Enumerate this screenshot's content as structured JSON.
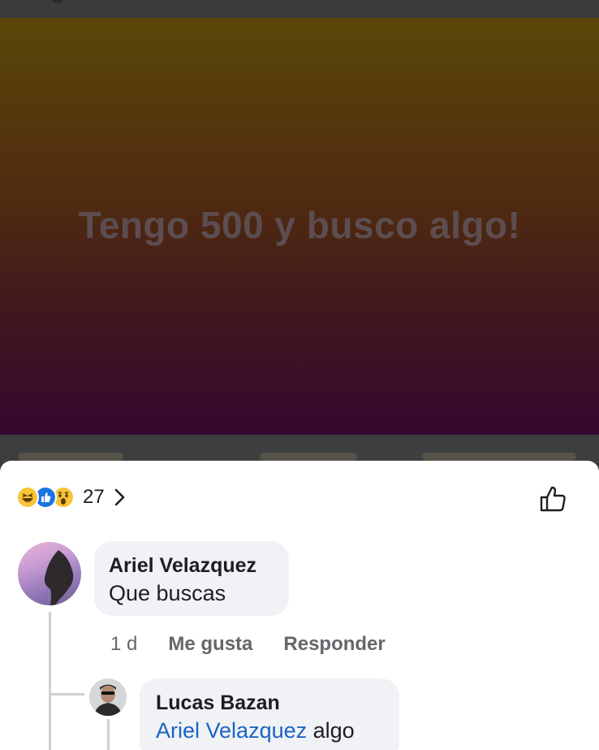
{
  "post": {
    "text": "Tengo 500 y busco algo!"
  },
  "reactions": {
    "icons": [
      "haha-icon",
      "like-icon",
      "wow-icon"
    ],
    "count": "27"
  },
  "comments": [
    {
      "author": "Ariel Velazquez",
      "text": "Que buscas",
      "time": "1 d",
      "like_label": "Me gusta",
      "reply_label": "Responder"
    }
  ],
  "replies": [
    {
      "author": "Lucas Bazan",
      "mention": "Ariel Velazquez",
      "text": "algo"
    }
  ],
  "colors": {
    "accent_blue": "#1b74e4",
    "mention_blue": "#1b64c4",
    "bubble_bg": "#f0f2f5",
    "meta_gray": "#65676b"
  }
}
